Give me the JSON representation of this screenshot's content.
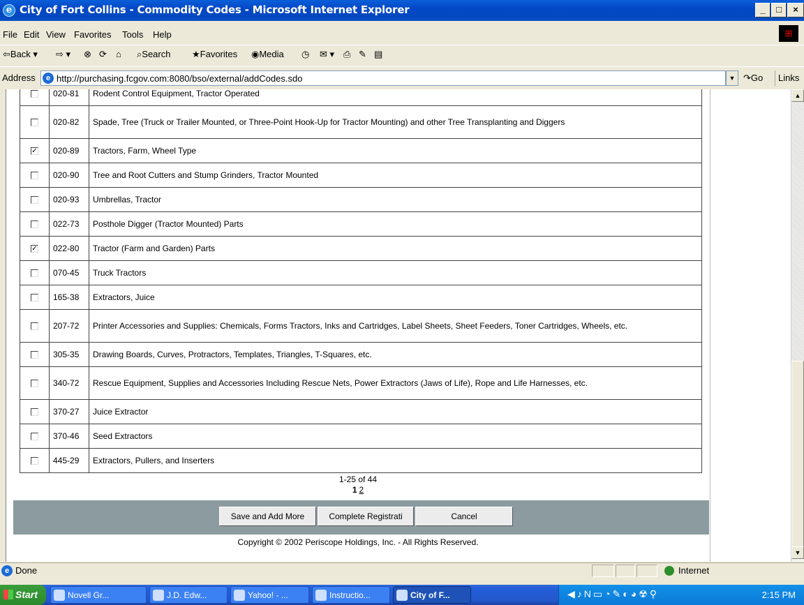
{
  "window": {
    "title": "City of Fort Collins - Commodity Codes - Microsoft Internet Explorer",
    "controls": [
      "_",
      "□",
      "×"
    ]
  },
  "menu": [
    "File",
    "Edit",
    "View",
    "Favorites",
    "Tools",
    "Help"
  ],
  "toolbar": {
    "back": "Back",
    "search": "Search",
    "favorites": "Favorites",
    "media": "Media"
  },
  "address": {
    "label": "Address",
    "url": "http://purchasing.fcgov.com:8080/bso/external/addCodes.sdo",
    "go": "Go",
    "links": "Links"
  },
  "rows": [
    {
      "checked": false,
      "code": "020-81",
      "desc": "Rodent Control Equipment, Tractor Operated"
    },
    {
      "checked": false,
      "code": "020-82",
      "desc": "Spade, Tree (Truck or Trailer Mounted, or Three-Point Hook-Up for Tractor Mounting) and other Tree Transplanting and Diggers"
    },
    {
      "checked": true,
      "code": "020-89",
      "desc": "Tractors, Farm, Wheel Type"
    },
    {
      "checked": false,
      "code": "020-90",
      "desc": "Tree and Root Cutters and Stump Grinders, Tractor Mounted"
    },
    {
      "checked": false,
      "code": "020-93",
      "desc": "Umbrellas, Tractor"
    },
    {
      "checked": false,
      "code": "022-73",
      "desc": "Posthole Digger (Tractor Mounted) Parts"
    },
    {
      "checked": true,
      "code": "022-80",
      "desc": "Tractor (Farm and Garden) Parts"
    },
    {
      "checked": false,
      "code": "070-45",
      "desc": "Truck Tractors"
    },
    {
      "checked": false,
      "code": "165-38",
      "desc": "Extractors, Juice"
    },
    {
      "checked": false,
      "code": "207-72",
      "desc": "Printer Accessories and Supplies: Chemicals, Forms Tractors, Inks and Cartridges, Label Sheets, Sheet Feeders, Toner Cartridges, Wheels, etc."
    },
    {
      "checked": false,
      "code": "305-35",
      "desc": "Drawing Boards, Curves, Protractors, Templates, Triangles, T-Squares, etc."
    },
    {
      "checked": false,
      "code": "340-72",
      "desc": "Rescue Equipment, Supplies and Accessories Including Rescue Nets, Power Extractors (Jaws of Life), Rope and Life Harnesses, etc."
    },
    {
      "checked": false,
      "code": "370-27",
      "desc": "Juice Extractor"
    },
    {
      "checked": false,
      "code": "370-46",
      "desc": "Seed Extractors"
    },
    {
      "checked": false,
      "code": "445-29",
      "desc": "Extractors, Pullers, and Inserters"
    }
  ],
  "pager": {
    "range": "1-25 of 44",
    "current": "1",
    "next": "2"
  },
  "buttons": {
    "save": "Save and Add More",
    "complete": "Complete Registrati",
    "cancel": "Cancel"
  },
  "copyright": "Copyright © 2002 Periscope Holdings, Inc. - All Rights Reserved.",
  "status": {
    "text": "Done",
    "zone": "Internet"
  },
  "taskbar": {
    "start": "Start",
    "tasks": [
      "Novell Gr...",
      "J.D. Edw...",
      "Yahoo! - ...",
      "Instructio...",
      "City of F..."
    ],
    "clock": "2:15 PM"
  }
}
